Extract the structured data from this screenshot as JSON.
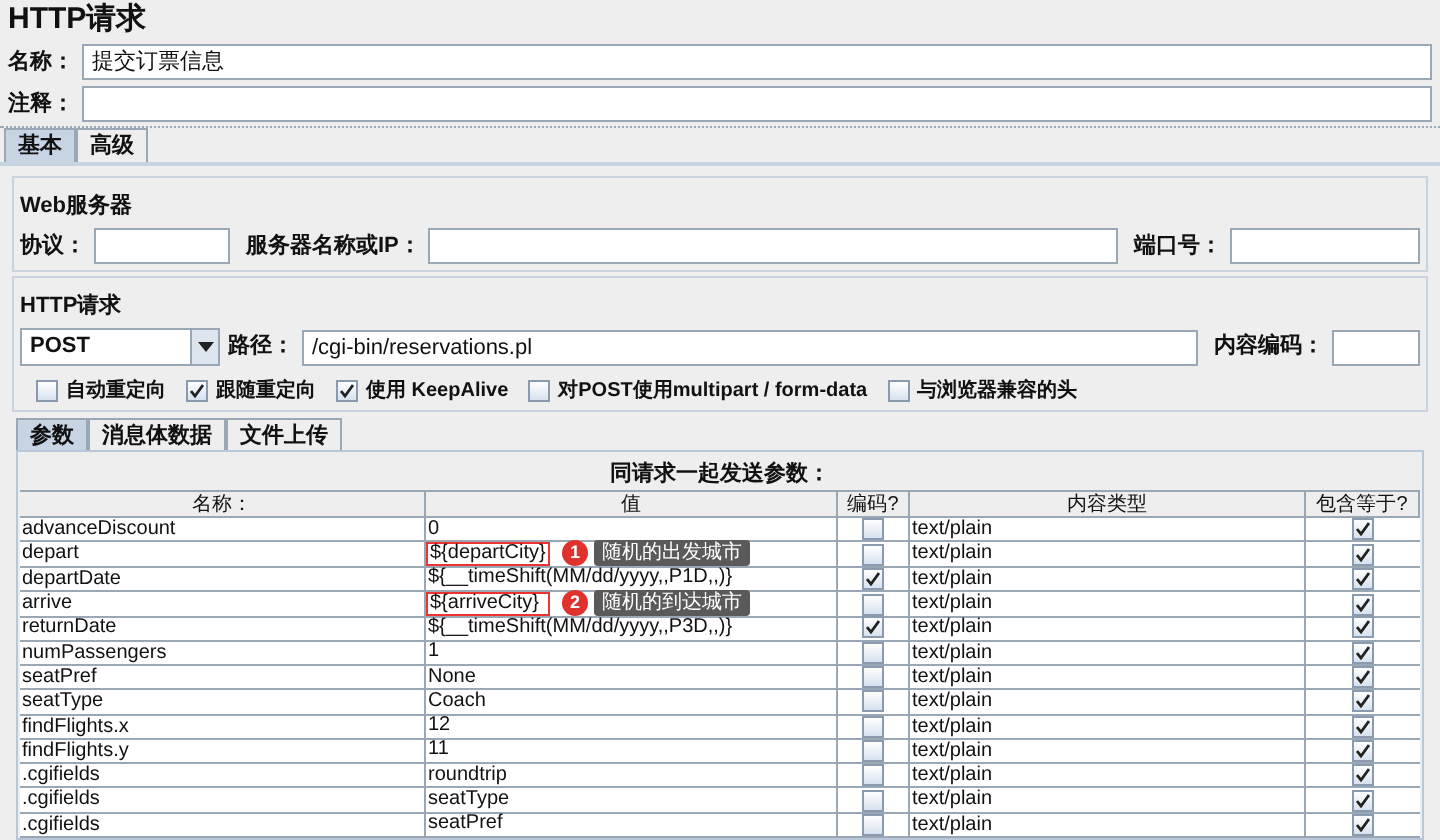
{
  "title": "HTTP请求",
  "name_field": {
    "label": "名称：",
    "value": "提交订票信息"
  },
  "comment_field": {
    "label": "注释："
  },
  "tabs": [
    {
      "label": "基本",
      "selected": true
    },
    {
      "label": "高级",
      "selected": false
    }
  ],
  "web_server": {
    "title": "Web服务器",
    "protocol_label": "协议：",
    "server_label": "服务器名称或IP：",
    "port_label": "端口号："
  },
  "http_request": {
    "title": "HTTP请求",
    "method": "POST",
    "path_label": "路径：",
    "path": "/cgi-bin/reservations.pl",
    "encoding_label": "内容编码：",
    "options": [
      {
        "label": "自动重定向",
        "checked": false
      },
      {
        "label": "跟随重定向",
        "checked": true
      },
      {
        "label": "使用 KeepAlive",
        "checked": true
      },
      {
        "label": "对POST使用multipart / form-data",
        "checked": false
      },
      {
        "label": "与浏览器兼容的头",
        "checked": false
      }
    ]
  },
  "sub_tabs": [
    {
      "label": "参数",
      "selected": true
    },
    {
      "label": "消息体数据",
      "selected": false
    },
    {
      "label": "文件上传",
      "selected": false
    }
  ],
  "params": {
    "caption": "同请求一起发送参数：",
    "columns": [
      "名称：",
      "值",
      "编码?",
      "内容类型",
      "包含等于?"
    ],
    "rows": [
      {
        "name": "advanceDiscount",
        "value": "0",
        "encode": false,
        "content_type": "text/plain",
        "include_equals": true
      },
      {
        "name": "depart",
        "value": "${departCity}",
        "encode": false,
        "content_type": "text/plain",
        "include_equals": true,
        "annotation": {
          "number": "1",
          "text": "随机的出发城市"
        }
      },
      {
        "name": "departDate",
        "value": "${__timeShift(MM/dd/yyyy,,P1D,,)}",
        "encode": true,
        "content_type": "text/plain",
        "include_equals": true
      },
      {
        "name": "arrive",
        "value": "${arriveCity}",
        "encode": false,
        "content_type": "text/plain",
        "include_equals": true,
        "annotation": {
          "number": "2",
          "text": "随机的到达城市"
        }
      },
      {
        "name": "returnDate",
        "value": "${__timeShift(MM/dd/yyyy,,P3D,,)}",
        "encode": true,
        "content_type": "text/plain",
        "include_equals": true
      },
      {
        "name": "numPassengers",
        "value": "1",
        "encode": false,
        "content_type": "text/plain",
        "include_equals": true
      },
      {
        "name": "seatPref",
        "value": "None",
        "encode": false,
        "content_type": "text/plain",
        "include_equals": true
      },
      {
        "name": "seatType",
        "value": "Coach",
        "encode": false,
        "content_type": "text/plain",
        "include_equals": true
      },
      {
        "name": "findFlights.x",
        "value": "12",
        "encode": false,
        "content_type": "text/plain",
        "include_equals": true
      },
      {
        "name": "findFlights.y",
        "value": "11",
        "encode": false,
        "content_type": "text/plain",
        "include_equals": true
      },
      {
        "name": ".cgifields",
        "value": "roundtrip",
        "encode": false,
        "content_type": "text/plain",
        "include_equals": true
      },
      {
        "name": ".cgifields",
        "value": "seatType",
        "encode": false,
        "content_type": "text/plain",
        "include_equals": true
      },
      {
        "name": ".cgifields",
        "value": "seatPref",
        "encode": false,
        "content_type": "text/plain",
        "include_equals": true
      }
    ]
  }
}
